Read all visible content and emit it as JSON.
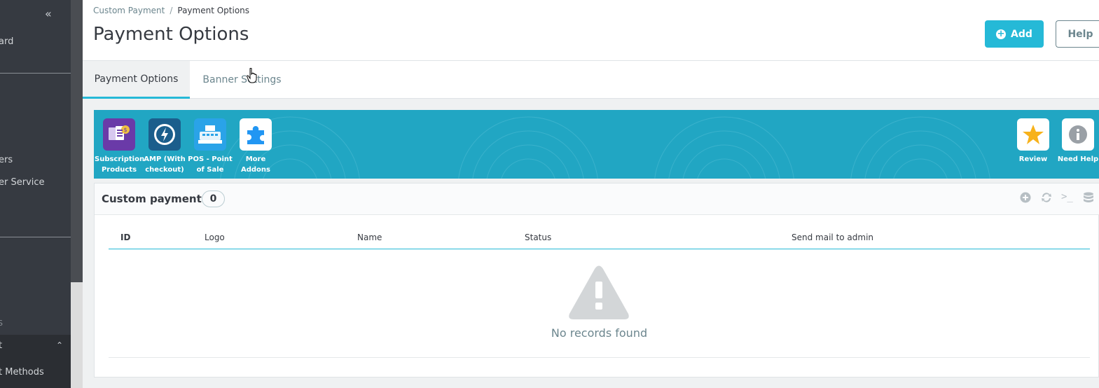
{
  "sidebar": {
    "collapse_icon": "double-chevron-left-icon",
    "items": [
      {
        "label": "ard"
      },
      {
        "label": "ers"
      },
      {
        "label": "er Service"
      },
      {
        "label": "S"
      },
      {
        "label": "t"
      },
      {
        "label": "t Methods"
      }
    ]
  },
  "breadcrumb": {
    "parent": "Custom Payment",
    "separator": "/",
    "current": "Payment Options"
  },
  "header": {
    "title": "Payment Options",
    "add_label": "Add",
    "help_label": "Help"
  },
  "tabs": [
    {
      "label": "Payment Options",
      "active": true
    },
    {
      "label": "Banner Settings",
      "active": false
    }
  ],
  "banner": {
    "bg_color": "#21a6c3",
    "addons": [
      {
        "label": "Subscription Products",
        "icon": "subscription-icon"
      },
      {
        "label": "AMP (With checkout)",
        "icon": "amp-lightning-icon"
      },
      {
        "label": "POS - Point of Sale",
        "icon": "cash-register-icon"
      },
      {
        "label": "More Addons",
        "icon": "puzzle-icon"
      }
    ],
    "review_label": "Review",
    "need_help_label": "Need Help"
  },
  "panel": {
    "title": "Custom payment",
    "count": "0",
    "columns": [
      "ID",
      "Logo",
      "Name",
      "Status",
      "Send mail to admin"
    ],
    "empty_text": "No records found"
  },
  "colors": {
    "accent": "#25b9d7",
    "sidebar_bg": "#363a41",
    "text": "#363a41",
    "muted": "#6c868e"
  }
}
